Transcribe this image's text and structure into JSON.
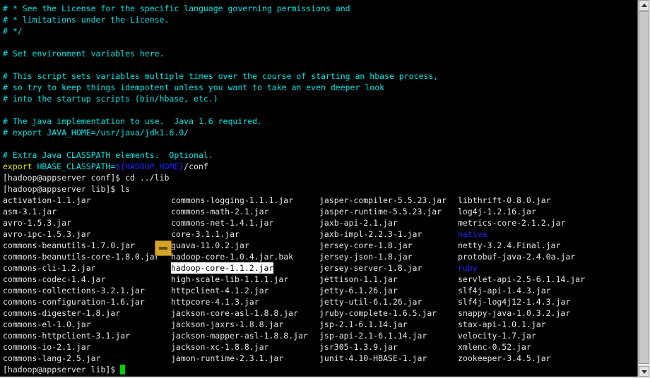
{
  "terminal": {
    "comment_lines": [
      "# * See the License for the specific language governing permissions and",
      "# * limitations under the License.",
      "# */",
      "",
      "# Set environment variables here.",
      "",
      "# This script sets variables multiple times over the course of starting an hbase process,",
      "# so try to keep things idempotent unless you want to take an even deeper look",
      "# into the startup scripts (bin/hbase, etc.)",
      "",
      "# The java implementation to use.  Java 1.6 required.",
      "# export JAVA_HOME=/usr/java/jdk1.6.0/",
      "",
      "# Extra Java CLASSPATH elements.  Optional."
    ],
    "export_line": {
      "keyword": "export",
      "var": " HBASE_CLASSPATH=",
      "ref": "${HADOOP_HOME}",
      "suffix": "/conf"
    },
    "cmd1": "[hadoop@appserver conf]$ cd ../lib",
    "cmd2": "[hadoop@appserver lib]$ ls",
    "final_prompt": "[hadoop@appserver lib]$ ",
    "ls_columns": [
      [
        "activation-1.1.jar",
        "asm-3.1.jar",
        "avro-1.5.3.jar",
        "avro-ipc-1.5.3.jar",
        "commons-beanutils-1.7.0.jar",
        "commons-beanutils-core-1.8.0.jar",
        "commons-cli-1.2.jar",
        "commons-codec-1.4.jar",
        "commons-collections-3.2.1.jar",
        "commons-configuration-1.6.jar",
        "commons-digester-1.8.jar",
        "commons-el-1.0.jar",
        "commons-httpclient-3.1.jar",
        "commons-io-2.1.jar",
        "commons-lang-2.5.jar"
      ],
      [
        "commons-logging-1.1.1.jar",
        "commons-math-2.1.jar",
        "commons-net-1.4.1.jar",
        "core-3.1.1.jar",
        "guava-11.0.2.jar",
        "hadoop-core-1.0.4.jar.bak",
        "hadoop-core-1.1.2.jar",
        "high-scale-lib-1.1.1.jar",
        "httpclient-4.1.2.jar",
        "httpcore-4.1.3.jar",
        "jackson-core-asl-1.8.8.jar",
        "jackson-jaxrs-1.8.8.jar",
        "jackson-mapper-asl-1.8.8.jar",
        "jackson-xc-1.8.8.jar",
        "jamon-runtime-2.3.1.jar"
      ],
      [
        "jasper-compiler-5.5.23.jar",
        "jasper-runtime-5.5.23.jar",
        "jaxb-api-2.1.jar",
        "jaxb-impl-2.2.3-1.jar",
        "jersey-core-1.8.jar",
        "jersey-json-1.8.jar",
        "jersey-server-1.8.jar",
        "jettison-1.1.jar",
        "jetty-6.1.26.jar",
        "jetty-util-6.1.26.jar",
        "jruby-complete-1.6.5.jar",
        "jsp-2.1-6.1.14.jar",
        "jsp-api-2.1-6.1.14.jar",
        "jsr305-1.3.9.jar",
        "junit-4.10-HBASE-1.jar"
      ],
      [
        "libthrift-0.8.0.jar",
        "log4j-1.2.16.jar",
        "metrics-core-2.1.2.jar",
        "native",
        "netty-3.2.4.Final.jar",
        "protobuf-java-2.4.0a.jar",
        "ruby",
        "servlet-api-2.5-6.1.14.jar",
        "slf4j-api-1.4.3.jar",
        "slf4j-log4j12-1.4.3.jar",
        "snappy-java-1.0.3.2.jar",
        "stax-api-1.0.1.jar",
        "velocity-1.7.jar",
        "xmlenc-0.52.jar",
        "zookeeper-3.4.5.jar"
      ]
    ],
    "directories": [
      "native",
      "ruby"
    ],
    "highlighted": "hadoop-core-1.1.2.jar"
  },
  "colors": {
    "comment": "#00e5e5",
    "keyword": "#e5e500",
    "directory": "#2222ff",
    "text": "#e5e5e5",
    "cursor": "#00d000"
  },
  "icons": {
    "drag_icon": "file-drag-icon",
    "scroll_up": "scroll-up-arrow-icon",
    "scroll_down": "scroll-down-arrow-icon"
  }
}
